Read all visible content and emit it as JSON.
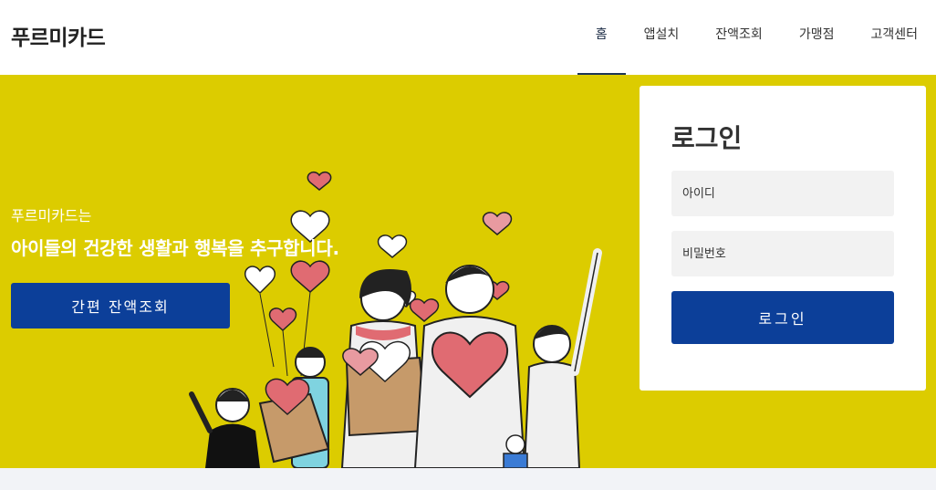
{
  "header": {
    "logo": "푸르미카드",
    "nav": [
      {
        "label": "홈",
        "active": true
      },
      {
        "label": "앱설치",
        "active": false
      },
      {
        "label": "잔액조회",
        "active": false
      },
      {
        "label": "가맹점",
        "active": false
      },
      {
        "label": "고객센터",
        "active": false
      }
    ]
  },
  "hero": {
    "subtitle": "푸르미카드는",
    "title": "아이들의 건강한 생활과 행복을 추구합니다.",
    "cta_label": "간편 잔액조회",
    "background_color": "#dccc00"
  },
  "login": {
    "title": "로그인",
    "id_placeholder": "아이디",
    "password_placeholder": "비밀번호",
    "submit_label": "로그인",
    "button_color": "#0c3f99"
  }
}
